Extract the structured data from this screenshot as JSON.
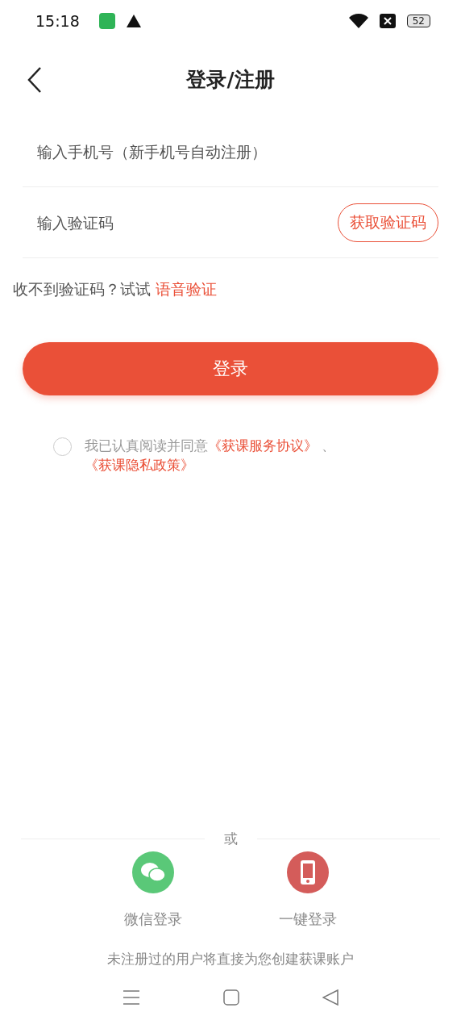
{
  "status_bar": {
    "time": "15:18",
    "battery": "52"
  },
  "header": {
    "title": "登录/注册"
  },
  "phone_field": {
    "placeholder": "输入手机号（新手机号自动注册）"
  },
  "code_field": {
    "placeholder": "输入验证码",
    "button": "获取验证码"
  },
  "voice_hint": {
    "text": "收不到验证码？试试",
    "link": "语音验证"
  },
  "login_button": "登录",
  "agreement": {
    "checked": false,
    "text": "我已认真阅读并同意",
    "links": [
      "《获课服务协议》",
      "《获课隐私政策》"
    ],
    "separator": "、"
  },
  "divider_label": "或",
  "alt_logins": [
    {
      "kind": "wechat",
      "label": "微信登录",
      "color": "#5ac878"
    },
    {
      "kind": "phone",
      "label": "一键登录",
      "color": "#d45c5a"
    }
  ],
  "footer_note": "未注册过的用户将直接为您创建获课账户"
}
